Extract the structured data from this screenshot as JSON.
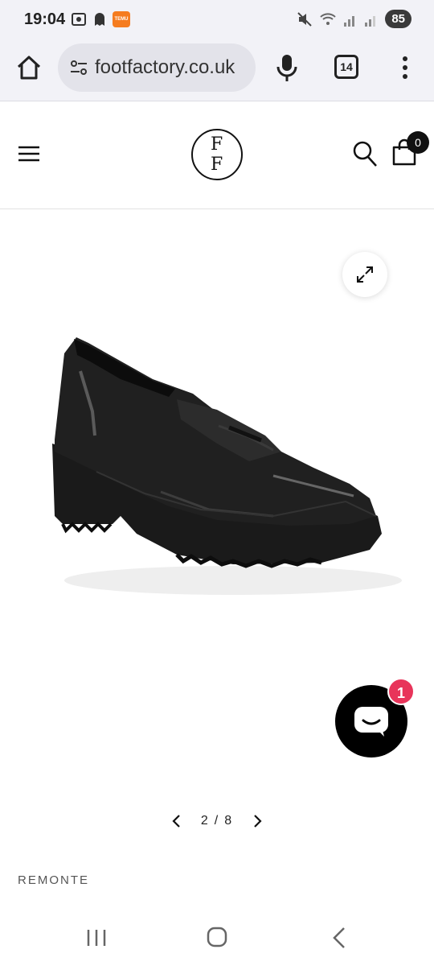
{
  "status_bar": {
    "time": "19:04",
    "battery": "85",
    "temu_badge": "TEMU"
  },
  "browser": {
    "url": "footfactory.co.uk",
    "tab_count": "14"
  },
  "site_header": {
    "logo_top": "F",
    "logo_bottom": "F",
    "cart_count": "0"
  },
  "gallery": {
    "current_page": "2",
    "separator": "/",
    "total_pages": "8",
    "product_image_icon": "black-patent-loafer-image"
  },
  "chat": {
    "badge_count": "1"
  },
  "product": {
    "brand": "REMONTE"
  },
  "colors": {
    "accent_badge": "#e8345a",
    "header_bg": "#f2f2f7"
  }
}
